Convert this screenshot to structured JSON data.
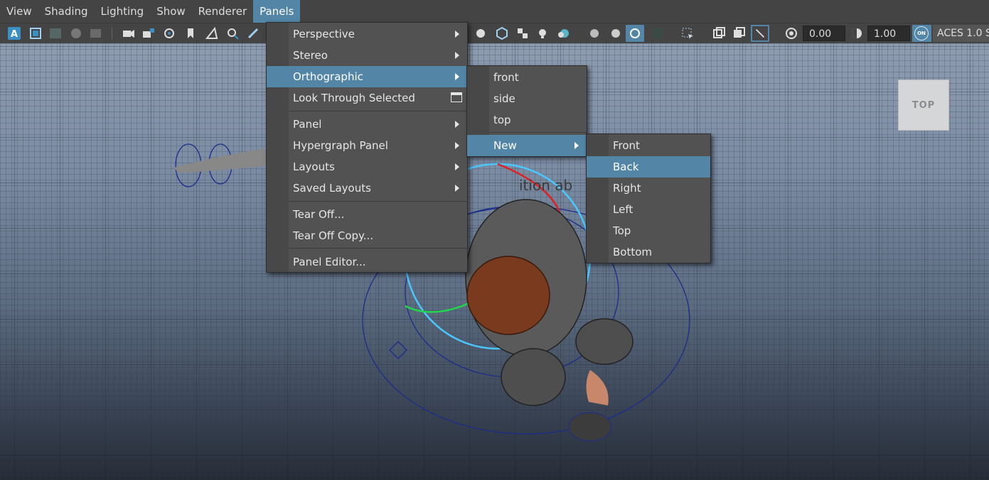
{
  "menubar": {
    "items": [
      {
        "label": "View"
      },
      {
        "label": "Shading"
      },
      {
        "label": "Lighting"
      },
      {
        "label": "Show"
      },
      {
        "label": "Renderer"
      },
      {
        "label": "Panels",
        "active": true
      }
    ]
  },
  "toolbar": {
    "exposure_value": "0.00",
    "gamma_value": "1.00",
    "color_mgmt_badge": "ON",
    "color_space": "ACES 1.0 S"
  },
  "viewport": {
    "viewcube_label": "TOP",
    "scene_text": "ition ab"
  },
  "panels_menu": {
    "items": [
      {
        "label": "Perspective",
        "submenu": true
      },
      {
        "label": "Stereo",
        "submenu": true
      },
      {
        "label": "Orthographic",
        "submenu": true,
        "highlighted": true
      },
      {
        "label": "Look Through Selected",
        "option_box": true
      },
      {
        "label": "Panel",
        "submenu": true
      },
      {
        "label": "Hypergraph Panel",
        "submenu": true
      },
      {
        "label": "Layouts",
        "submenu": true
      },
      {
        "label": "Saved Layouts",
        "submenu": true
      },
      {
        "label": "Tear Off..."
      },
      {
        "label": "Tear Off Copy..."
      },
      {
        "label": "Panel Editor..."
      }
    ]
  },
  "orthographic_menu": {
    "items": [
      {
        "label": "front"
      },
      {
        "label": "side"
      },
      {
        "label": "top"
      },
      {
        "label": "New",
        "submenu": true,
        "highlighted": true
      }
    ]
  },
  "new_menu": {
    "items": [
      {
        "label": "Front"
      },
      {
        "label": "Back",
        "highlighted": true
      },
      {
        "label": "Right"
      },
      {
        "label": "Left"
      },
      {
        "label": "Top"
      },
      {
        "label": "Bottom"
      }
    ]
  },
  "colors": {
    "accent": "#5285a6",
    "menu_bg": "#525252",
    "bar_bg": "#444444"
  }
}
